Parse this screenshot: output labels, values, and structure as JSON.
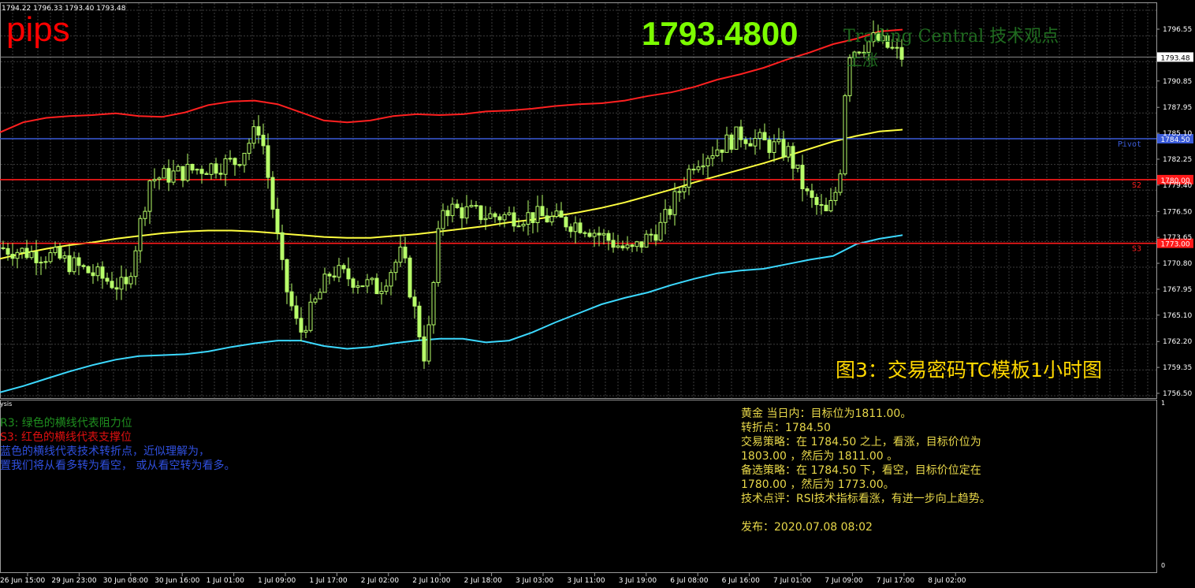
{
  "header": {
    "ohlc_text": "1794.22 1796.33 1793.40 1793.48",
    "pips_label": "pips",
    "current_price_big": "1793.4800",
    "tc_watermark": "Trading Central 技术观点",
    "tc_direction": "上涨"
  },
  "caption": "图3：交易密码TC模板1小时图",
  "colors": {
    "background": "#000000",
    "grid": "#3c3c3c",
    "candle": "#b8ff6a",
    "pivot_line": "#3a5bd9",
    "support_line": "#ff1a1a",
    "band_upper": "#ff2020",
    "band_middle": "#ffff40",
    "band_lower": "#3cd9ff"
  },
  "price_axis": {
    "ticks": [
      "1796.55",
      "1793.48",
      "1790.85",
      "1787.95",
      "1785.10",
      "1784.50",
      "1782.25",
      "1780.00",
      "1779.40",
      "1776.50",
      "1773.65",
      "1773.00",
      "1770.80",
      "1767.95",
      "1765.10",
      "1762.20",
      "1759.35",
      "1756.50"
    ],
    "current_price": "1793.48"
  },
  "levels": [
    {
      "name": "Pivot",
      "price": 1784.5,
      "label": "1784.50",
      "kind": "pivot"
    },
    {
      "name": "S2",
      "price": 1780.0,
      "label": "1780.00",
      "kind": "support"
    },
    {
      "name": "S3",
      "price": 1773.0,
      "label": "1773.00",
      "kind": "support"
    }
  ],
  "time_axis": {
    "labels": [
      "26 Jun 15:00",
      "29 Jun 23:00",
      "30 Jun 08:00",
      "30 Jun 16:00",
      "1 Jul 01:00",
      "1 Jul 09:00",
      "1 Jul 17:00",
      "2 Jul 02:00",
      "2 Jul 10:00",
      "2 Jul 18:00",
      "3 Jul 03:00",
      "3 Jul 11:00",
      "3 Jul 19:00",
      "6 Jul 08:00",
      "6 Jul 16:00",
      "7 Jul 01:00",
      "7 Jul 09:00",
      "7 Jul 17:00",
      "8 Jul 02:00"
    ]
  },
  "indicator_panel": {
    "label": "ysis",
    "scale_top": "1",
    "scale_bottom": "0"
  },
  "legend": [
    {
      "text": "R3: 绿色的横线代表阻力位",
      "color": "#1f8f1f"
    },
    {
      "text": "S3: 红色的横线代表支撑位",
      "color": "#e01010"
    },
    {
      "text": "蓝色的横线代表技术转折点，近似理解为，",
      "color": "#3050e0"
    },
    {
      "text": "置我们将从看多转为看空， 或从看空转为看多。",
      "color": "#3050e0"
    }
  ],
  "analysis": [
    "黄金 当日内：目标位为1811.00。",
    "转折点：1784.50",
    "交易策略：在 1784.50 之上，看涨，目标价位为",
    "1803.00 ，然后为 1811.00 。",
    "备选策略：在 1784.50 下，看空，目标价位定在",
    "1780.00 ，然后为 1773.00。",
    "技术点评：RSI技术指标看涨，有进一步向上趋势。",
    "",
    "发布：2020.07.08 08:02"
  ],
  "chart_data": {
    "type": "candlestick",
    "instrument": "黄金",
    "ylim": [
      1756.5,
      1798.0
    ],
    "series": [
      {
        "name": "upper_band",
        "values": [
          1785.2,
          1786.3,
          1786.8,
          1787.0,
          1787.1,
          1787.3,
          1787.0,
          1786.9,
          1787.4,
          1788.2,
          1788.6,
          1788.7,
          1788.3,
          1787.4,
          1786.5,
          1786.3,
          1786.5,
          1787.0,
          1787.2,
          1787.1,
          1787.2,
          1787.5,
          1787.6,
          1787.8,
          1788.1,
          1788.3,
          1788.4,
          1788.7,
          1789.2,
          1789.6,
          1790.2,
          1791.0,
          1791.6,
          1792.3,
          1793.2,
          1794.0,
          1794.9,
          1795.5,
          1796.3,
          1796.5
        ]
      },
      {
        "name": "middle_band",
        "values": [
          1771.3,
          1771.9,
          1772.4,
          1772.8,
          1773.1,
          1773.5,
          1773.8,
          1774.1,
          1774.3,
          1774.4,
          1774.4,
          1774.3,
          1774.1,
          1773.9,
          1773.7,
          1773.6,
          1773.6,
          1773.8,
          1774.0,
          1774.3,
          1774.6,
          1774.9,
          1775.3,
          1775.6,
          1776.0,
          1776.4,
          1776.9,
          1777.5,
          1778.2,
          1778.9,
          1779.7,
          1780.4,
          1781.1,
          1781.8,
          1782.6,
          1783.4,
          1784.2,
          1784.8,
          1785.3,
          1785.5
        ]
      },
      {
        "name": "lower_band",
        "values": [
          1756.6,
          1757.3,
          1758.1,
          1758.9,
          1759.6,
          1760.2,
          1760.6,
          1760.7,
          1760.8,
          1761.1,
          1761.6,
          1762.0,
          1762.3,
          1762.3,
          1761.7,
          1761.4,
          1761.6,
          1762.0,
          1762.3,
          1762.5,
          1762.5,
          1762.1,
          1762.3,
          1763.2,
          1764.3,
          1765.3,
          1766.3,
          1767.0,
          1767.6,
          1768.4,
          1769.1,
          1769.7,
          1770.0,
          1770.2,
          1770.7,
          1771.2,
          1771.6,
          1772.9,
          1773.5,
          1773.9
        ]
      }
    ]
  }
}
